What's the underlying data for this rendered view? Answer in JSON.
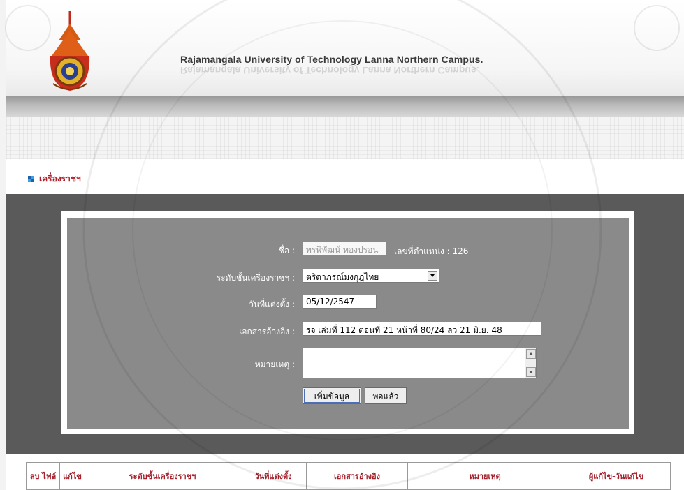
{
  "header": {
    "university_title": "Rajamangala University of Technology Lanna Northern Campus."
  },
  "section": {
    "title": "เครื่องราชฯ"
  },
  "form": {
    "name_label": "ชื่อ :",
    "name_value": "พรพิพัฒน์ ทองปรอน",
    "position_label": "เลขที่ตำแหน่ง : 126",
    "level_label": "ระดับชั้นเครื่องราชฯ :",
    "level_value": "ตริตาภรณ์มงกุฎไทย",
    "date_label": "วันที่แต่งตั้ง :",
    "date_value": "05/12/2547",
    "reference_label": "เอกสารอ้างอิง :",
    "reference_value": "รจ เล่มที่ 112 ตอนที่ 21 หน้าที่ 80/24 ลว 21 มิ.ย. 48",
    "note_label": "หมายเหตุ :",
    "note_value": "",
    "add_button": "เพิ่มข้อมูล",
    "done_button": "พอแล้ว"
  },
  "table": {
    "columns": [
      "ลบ ไฟล์",
      "แก้ไข",
      "ระดับชั้นเครื่องราชฯ",
      "วันที่แต่งตั้ง",
      "เอกสารอ้างอิง",
      "หมายเหตุ",
      "ผู้แก้ไข-วันแก้ไข"
    ]
  },
  "icons": {
    "logo": "university-emblem-icon",
    "section": "bullet-squares-icon",
    "select_arrow": "chevron-down-icon"
  },
  "colors": {
    "accent_red": "#b0202a",
    "panel_gray": "#8a8a8a",
    "dark_gray": "#5a5a5a"
  }
}
